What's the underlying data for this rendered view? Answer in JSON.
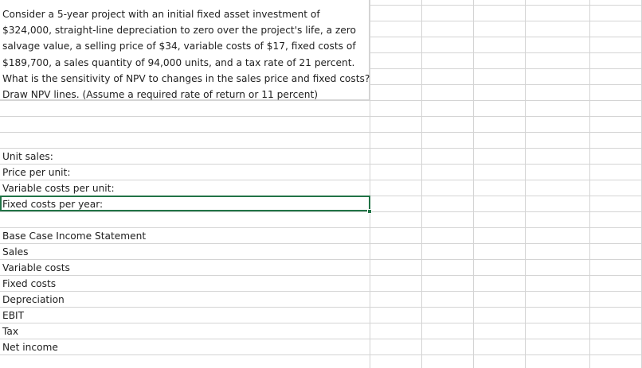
{
  "problem": {
    "text": "Consider a 5-year project with an initial fixed asset investment of\n$324,000, straight-line depreciation to zero over the project's life, a zero\nsalvage value, a selling price of $34, variable costs of $17, fixed costs of\n$189,700, a sales quantity of 94,000 units, and a tax rate of 21 percent.\nWhat is the sensitivity of NPV to changes in the sales price and fixed costs?\nDraw NPV lines. (Assume a required rate of return or 11 percent)"
  },
  "inputs": {
    "unit_sales": "Unit sales:",
    "price_per_unit": "Price per unit:",
    "variable_costs_per_unit": "Variable costs per unit:",
    "fixed_costs_per_year": "Fixed costs per year:"
  },
  "income_statement": {
    "title": "Base Case Income Statement",
    "sales": "Sales",
    "variable_costs": "Variable costs",
    "fixed_costs": "Fixed costs",
    "depreciation": "Depreciation",
    "ebit": "EBIT",
    "tax": "Tax",
    "net_income": "Net income"
  },
  "colors": {
    "gridline": "#d4d4d4",
    "selection": "#217346"
  }
}
